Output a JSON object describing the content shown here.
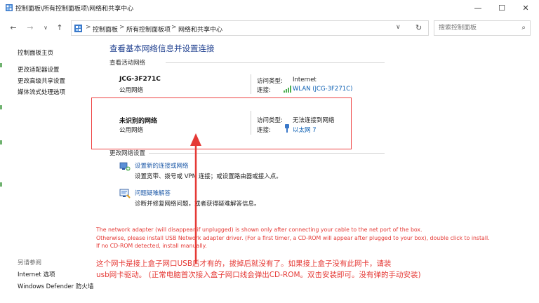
{
  "window": {
    "title": "控制面板\\所有控制面板项\\网络和共享中心",
    "minimize": "—",
    "maximize": "☐",
    "close": "✕"
  },
  "nav": {
    "back": "←",
    "forward": "→",
    "recent": "∨",
    "up": "↑"
  },
  "address": {
    "crumbs": [
      "控制面板",
      "所有控制面板项",
      "网络和共享中心"
    ],
    "separator": ">",
    "dropdown": "∨",
    "refresh": "↻"
  },
  "search": {
    "placeholder": "搜索控制面板",
    "icon": "search-icon"
  },
  "sidebar": {
    "home": "控制面板主页",
    "items": [
      "更改适配器设置",
      "更改高级共享设置",
      "媒体流式处理选项"
    ],
    "see_also_heading": "另请参阅",
    "see_also": [
      "Internet 选项",
      "Windows Defender 防火墙"
    ]
  },
  "main": {
    "title": "查看基本网络信息并设置连接",
    "active_networks_label": "查看活动网络",
    "networks": [
      {
        "name": "JCG-3F271C",
        "category": "公用网络",
        "access_key": "访问类型:",
        "access_value": "Internet",
        "conn_key": "连接:",
        "conn_value": "WLAN (JCG-3F271C)"
      },
      {
        "name": "未识别的网络",
        "category": "公用网络",
        "access_key": "访问类型:",
        "access_value": "无法连接到网络",
        "conn_key": "连接:",
        "conn_value": "以太网 7"
      }
    ],
    "change_settings_label": "更改网络设置",
    "tasks": [
      {
        "link": "设置新的连接或网络",
        "desc": "设置宽带、拨号或 VPN 连接；或设置路由器或接入点。",
        "icon": "new-connection-icon"
      },
      {
        "link": "问题疑难解答",
        "desc": "诊断并修复网络问题，或者获得疑难解答信息。",
        "icon": "troubleshoot-icon"
      }
    ]
  },
  "annotation": {
    "en_lines": [
      "The network adapter (will disappear if unplugged) is shown only after connecting your cable to the net port of the box.",
      "Otherwise, please install USB Network adapter driver. (For a first timer, a CD-ROM will appear after plugged to your box), double click to install.",
      "If no CD-ROM detected, install manually."
    ],
    "cn_lines": [
      "这个网卡是接上盒子网口USB后才有的，拔掉后就没有了。如果接上盒子没有此网卡，请装",
      "usb网卡驱动。 (正常电脑首次接入盒子网口线会弹出CD-ROM。双击安装即可。没有弹的手动安装)"
    ],
    "color": "#e53935"
  },
  "colors": {
    "accent": "#1e3f8f",
    "link": "#0b5fb3",
    "annotation_red": "#e53935"
  }
}
